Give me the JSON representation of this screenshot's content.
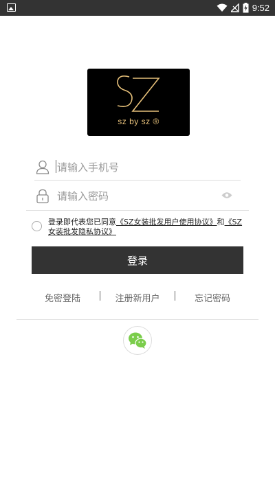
{
  "status_bar": {
    "time": "9:52"
  },
  "logo": {
    "brand_text": "sz by sz ®"
  },
  "phone_field": {
    "placeholder": "请输入手机号"
  },
  "password_field": {
    "placeholder": "请输入密码"
  },
  "agreement": {
    "prefix": "登录即代表您已同意",
    "user_agreement": "《SZ女装批发用户使用协议》",
    "conjunction": "和",
    "privacy_agreement": "《SZ女装批发隐私协议》"
  },
  "login_button": {
    "label": "登录"
  },
  "links": {
    "passwordless_login": "免密登陆",
    "register": "注册新用户",
    "forgot_password": "忘记密码"
  },
  "third_party": {
    "icon": "wechat-icon"
  },
  "colors": {
    "primary": "#333333",
    "logo_gold": "#e6c07a",
    "wechat_green": "#7bcd4b"
  }
}
